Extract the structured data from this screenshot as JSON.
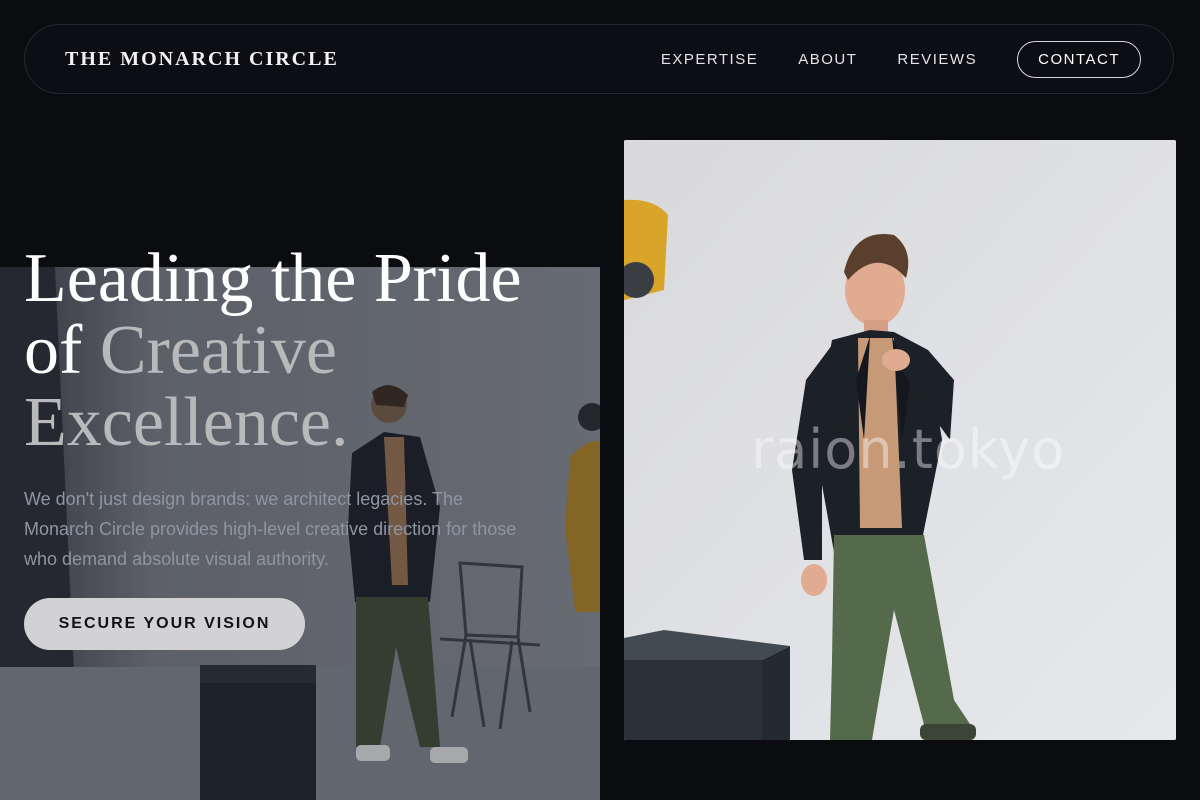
{
  "nav": {
    "brand": "THE MONARCH CIRCLE",
    "links": [
      "EXPERTISE",
      "ABOUT",
      "REVIEWS"
    ],
    "contact_label": "CONTACT"
  },
  "hero": {
    "title_line1": "Leading the Pride",
    "title_line2_prefix": "of ",
    "title_line2_accent": "Creative",
    "title_line3": "Excellence.",
    "description": "We don't just design brands: we architect legacies. The Monarch Circle provides high-level creative direction for those who demand absolute visual authority.",
    "cta_label": "SECURE YOUR VISION"
  },
  "images": {
    "left_photo": "fashion-studio-shoot-photo",
    "right_photo": "model-portrait-photo",
    "right_watermark": "raion.tokyo"
  },
  "colors": {
    "background": "#0b0c10",
    "accent_text": "#b9b9bb",
    "cta_background": "#d2d2d4"
  }
}
